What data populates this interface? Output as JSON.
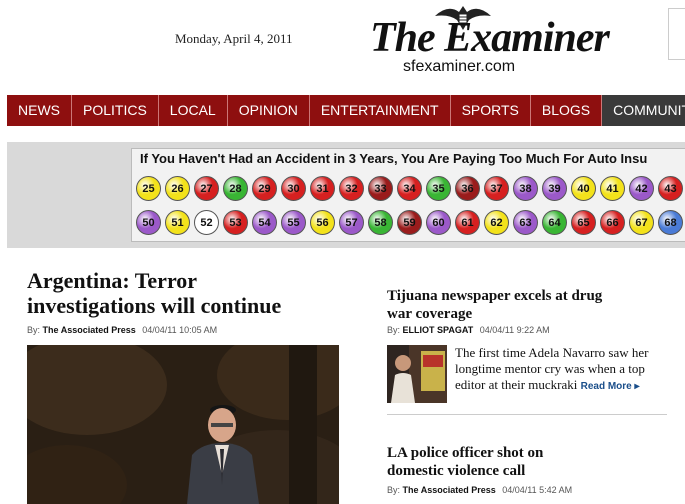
{
  "header": {
    "date": "Monday, April 4, 2011",
    "logo_title": "The Examiner",
    "logo_url": "sfexaminer.com"
  },
  "nav": {
    "items": [
      "NEWS",
      "POLITICS",
      "LOCAL",
      "OPINION",
      "ENTERTAINMENT",
      "SPORTS",
      "BLOGS",
      "COMMUNITY"
    ],
    "active": "COMMUNITY"
  },
  "ad": {
    "title": "If You Haven't Had an Accident in 3 Years, You Are Paying Too Much For Auto Insu",
    "row1": [
      {
        "n": "25",
        "c": "#f3e21b"
      },
      {
        "n": "26",
        "c": "#f3e21b"
      },
      {
        "n": "27",
        "c": "#d62020"
      },
      {
        "n": "28",
        "c": "#39b534"
      },
      {
        "n": "29",
        "c": "#d62020"
      },
      {
        "n": "30",
        "c": "#d62020"
      },
      {
        "n": "31",
        "c": "#d62020"
      },
      {
        "n": "32",
        "c": "#d62020"
      },
      {
        "n": "33",
        "c": "#9a1c1c"
      },
      {
        "n": "34",
        "c": "#d62020"
      },
      {
        "n": "35",
        "c": "#39b534"
      },
      {
        "n": "36",
        "c": "#9a1c1c"
      },
      {
        "n": "37",
        "c": "#d62020"
      },
      {
        "n": "38",
        "c": "#9b59c9"
      },
      {
        "n": "39",
        "c": "#9b59c9"
      },
      {
        "n": "40",
        "c": "#f3e21b"
      },
      {
        "n": "41",
        "c": "#f3e21b"
      },
      {
        "n": "42",
        "c": "#9b59c9"
      },
      {
        "n": "43",
        "c": "#d62020"
      }
    ],
    "row2": [
      {
        "n": "50",
        "c": "#9b59c9"
      },
      {
        "n": "51",
        "c": "#f3e21b"
      },
      {
        "n": "52",
        "c": "#ffffff"
      },
      {
        "n": "53",
        "c": "#d62020"
      },
      {
        "n": "54",
        "c": "#9b59c9"
      },
      {
        "n": "55",
        "c": "#9b59c9"
      },
      {
        "n": "56",
        "c": "#f3e21b"
      },
      {
        "n": "57",
        "c": "#9b59c9"
      },
      {
        "n": "58",
        "c": "#39b534"
      },
      {
        "n": "59",
        "c": "#9a1c1c"
      },
      {
        "n": "60",
        "c": "#9b59c9"
      },
      {
        "n": "61",
        "c": "#d62020"
      },
      {
        "n": "62",
        "c": "#f3e21b"
      },
      {
        "n": "63",
        "c": "#9b59c9"
      },
      {
        "n": "64",
        "c": "#39b534"
      },
      {
        "n": "65",
        "c": "#d62020"
      },
      {
        "n": "66",
        "c": "#d62020"
      },
      {
        "n": "67",
        "c": "#f3e21b"
      },
      {
        "n": "68",
        "c": "#4a7bd6"
      }
    ]
  },
  "main_story": {
    "headline_line1": "Argentina: Terror",
    "headline_line2": "investigations will continue",
    "by_label": "By:",
    "author": "The Associated Press",
    "timestamp": "04/04/11 10:05 AM"
  },
  "story2": {
    "headline_line1": "Tijuana newspaper excels at drug",
    "headline_line2": "war coverage",
    "by_label": "By:",
    "author": "ELLIOT SPAGAT",
    "timestamp": "04/04/11 9:22 AM",
    "teaser": "The first time Adela Navarro saw her longtime mentor cry was when a top editor at their muckraki",
    "read_more": "Read More ▸"
  },
  "story3": {
    "headline_line1": "LA police officer shot on",
    "headline_line2": "domestic violence call",
    "by_label": "By:",
    "author": "The Associated Press",
    "timestamp": "04/04/11 5:42 AM"
  }
}
